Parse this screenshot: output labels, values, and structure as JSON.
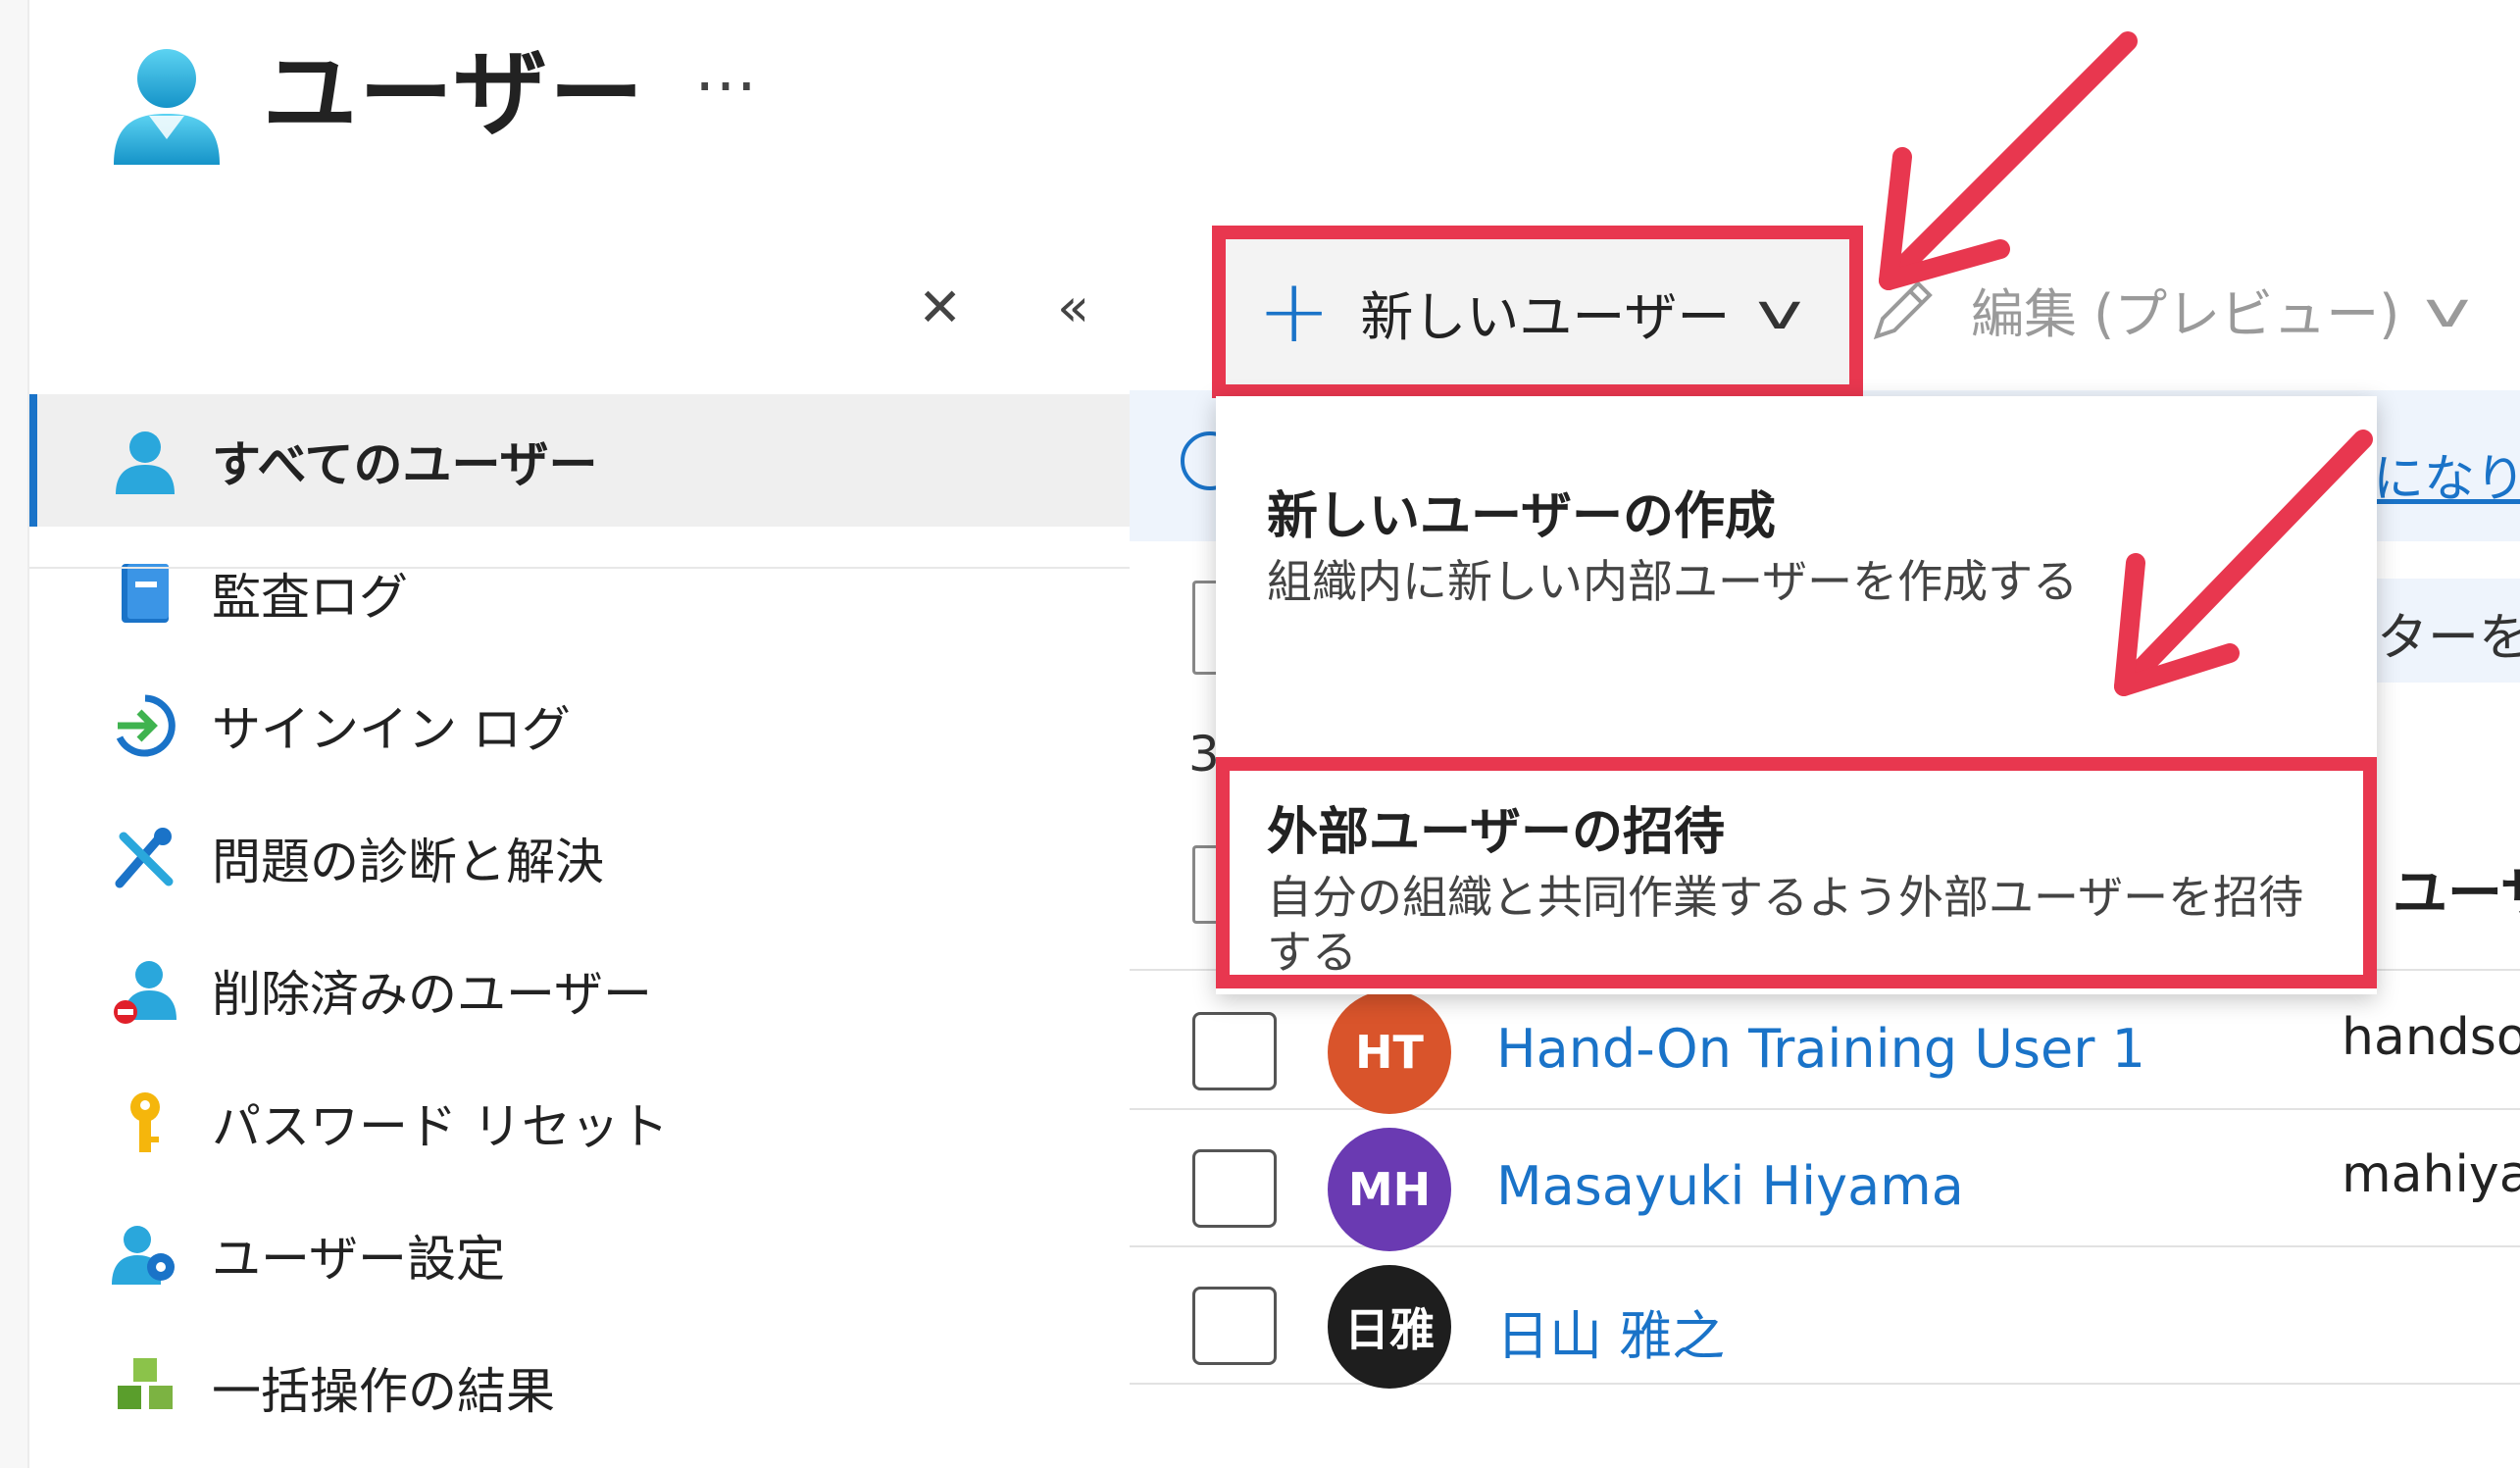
{
  "header": {
    "title": "ユーザー",
    "more": "…"
  },
  "controls": {
    "close": "✕",
    "collapse": "«"
  },
  "sidebar": {
    "items": [
      {
        "label": "すべてのユーザー",
        "icon": "user-icon"
      },
      {
        "label": "監査ログ",
        "icon": "book-icon"
      },
      {
        "label": "サインイン ログ",
        "icon": "sign-in-icon"
      },
      {
        "label": "問題の診断と解決",
        "icon": "wrench-icon"
      },
      {
        "label": "削除済みのユーザー",
        "icon": "deleted-user-icon"
      },
      {
        "label": "パスワード リセット",
        "icon": "key-icon"
      },
      {
        "label": "ユーザー設定",
        "icon": "user-settings-icon"
      },
      {
        "label": "一括操作の結果",
        "icon": "cubes-icon"
      }
    ]
  },
  "toolbar": {
    "new_user_label": "新しいユーザー",
    "edit_label": "編集 (プレビュー)"
  },
  "menu": {
    "create_title": "新しいユーザーの作成",
    "create_desc": "組織内に新しい内部ユーザーを作成する",
    "invite_title": "外部ユーザーの招待",
    "invite_desc": "自分の組織と共同作業するよう外部ユーザーを招待する"
  },
  "main": {
    "info_link": "になり",
    "filter_text": "ターを",
    "count_text": "3",
    "column_header": "ユーザ"
  },
  "users": [
    {
      "initials": "HT",
      "name": "Hand-On Training User 1",
      "upn": "handso",
      "color": "#d9542b"
    },
    {
      "initials": "MH",
      "name": "Masayuki Hiyama",
      "upn": "mahiyar",
      "color": "#6a3ab2"
    },
    {
      "initials": "日雅",
      "name": "日山 雅之",
      "upn": "",
      "color": "#1e1e1e"
    }
  ],
  "colors": {
    "highlight": "#e8374f",
    "accent": "#1a73c8"
  }
}
